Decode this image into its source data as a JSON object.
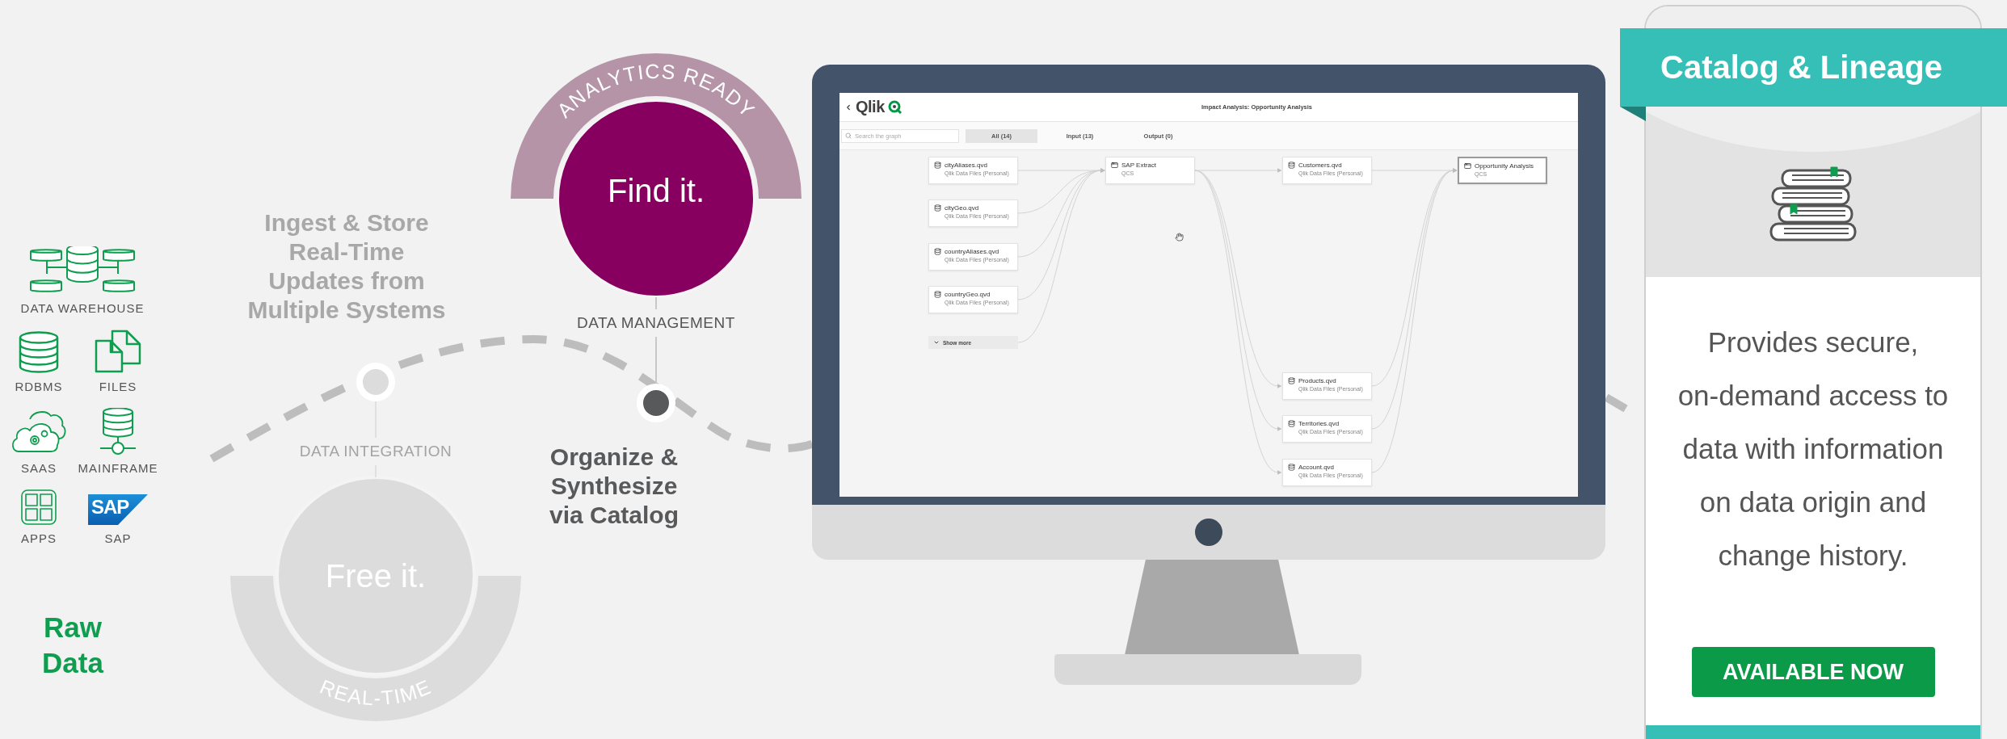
{
  "sources": [
    {
      "kind": "warehouse",
      "label": "DATA WAREHOUSE"
    },
    {
      "kind": "rdbms",
      "label": "RDBMS"
    },
    {
      "kind": "files",
      "label": "FILES"
    },
    {
      "kind": "saas",
      "label": "SAAS"
    },
    {
      "kind": "mainframe",
      "label": "MAINFRAME"
    },
    {
      "kind": "apps",
      "label": "APPS"
    },
    {
      "kind": "sap",
      "label": "SAP",
      "logo_text": "SAP"
    }
  ],
  "sources_title": "Raw Data",
  "stages": [
    {
      "kind": "integration",
      "active": false,
      "caption": "Ingest & Store Real-Time Updates from Multiple Systems",
      "node_label": "DATA INTEGRATION",
      "circle_text": "Free it.",
      "arc_text": "REAL-TIME"
    },
    {
      "kind": "management",
      "active": true,
      "caption": "Organize & Synthesize via Catalog",
      "node_label": "DATA MANAGEMENT",
      "circle_text": "Find it.",
      "arc_text": "ANALYTICS READY"
    }
  ],
  "app": {
    "logo_text": "Qlik",
    "title": "Impact Analysis: Opportunity Analysis",
    "search": {
      "placeholder": "Search the graph"
    },
    "tabs": [
      {
        "label": "All (14)",
        "selected": true
      },
      {
        "label": "Input (13)",
        "selected": false
      },
      {
        "label": "Output (0)",
        "selected": false
      }
    ],
    "graph": {
      "columns": [
        {
          "show_more": "Show more",
          "nodes": [
            {
              "kind": "file",
              "name": "cityAliases.qvd",
              "source": "Qlik Data Files (Personal)",
              "selected": false
            },
            {
              "kind": "file",
              "name": "cityGeo.qvd",
              "source": "Qlik Data Files (Personal)",
              "selected": false
            },
            {
              "kind": "file",
              "name": "countryAliases.qvd",
              "source": "Qlik Data Files (Personal)",
              "selected": false
            },
            {
              "kind": "file",
              "name": "countryGeo.qvd",
              "source": "Qlik Data Files (Personal)",
              "selected": false
            }
          ]
        },
        {
          "nodes": [
            {
              "kind": "app",
              "name": "SAP Extract",
              "source": "QCS",
              "selected": false
            }
          ]
        },
        {
          "nodes": [
            {
              "kind": "file",
              "name": "Customers.qvd",
              "source": "Qlik Data Files (Personal)",
              "selected": false
            },
            {
              "kind": "file",
              "name": "Products.qvd",
              "source": "Qlik Data Files (Personal)",
              "selected": false
            },
            {
              "kind": "file",
              "name": "Territories.qvd",
              "source": "Qlik Data Files (Personal)",
              "selected": false
            },
            {
              "kind": "file",
              "name": "Account.qvd",
              "source": "Qlik Data Files (Personal)",
              "selected": false
            }
          ]
        },
        {
          "nodes": [
            {
              "kind": "app",
              "name": "Opportunity Analysis",
              "source": "QCS",
              "selected": true
            }
          ]
        }
      ]
    }
  },
  "card": {
    "title": "Catalog & Lineage",
    "description": "Provides secure, on-demand access to data with information on data origin and change history.",
    "button": "AVAILABLE NOW"
  }
}
